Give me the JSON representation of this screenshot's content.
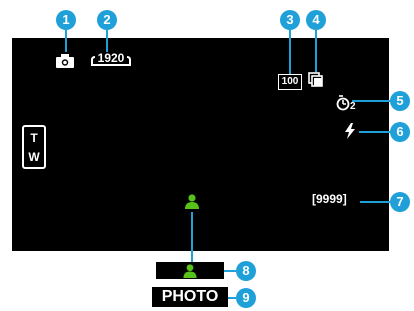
{
  "callouts": [
    "1",
    "2",
    "3",
    "4",
    "5",
    "6",
    "7",
    "8",
    "9"
  ],
  "status": {
    "resolution": "1920",
    "quality": "100",
    "self_timer": "2",
    "remaining_shots": "[9999]",
    "zoom_tele": "T",
    "zoom_wide": "W",
    "mode_label": "PHOTO"
  },
  "icons": {
    "capture_mode": "camera-icon",
    "continuous": "continuous-shooting-icon",
    "timer": "self-timer-icon",
    "flash": "flash-icon",
    "face": "face-detection-icon"
  },
  "colors": {
    "callout": "#1fa0d8",
    "screen": "#000000",
    "face_icon": "#56c21a"
  }
}
